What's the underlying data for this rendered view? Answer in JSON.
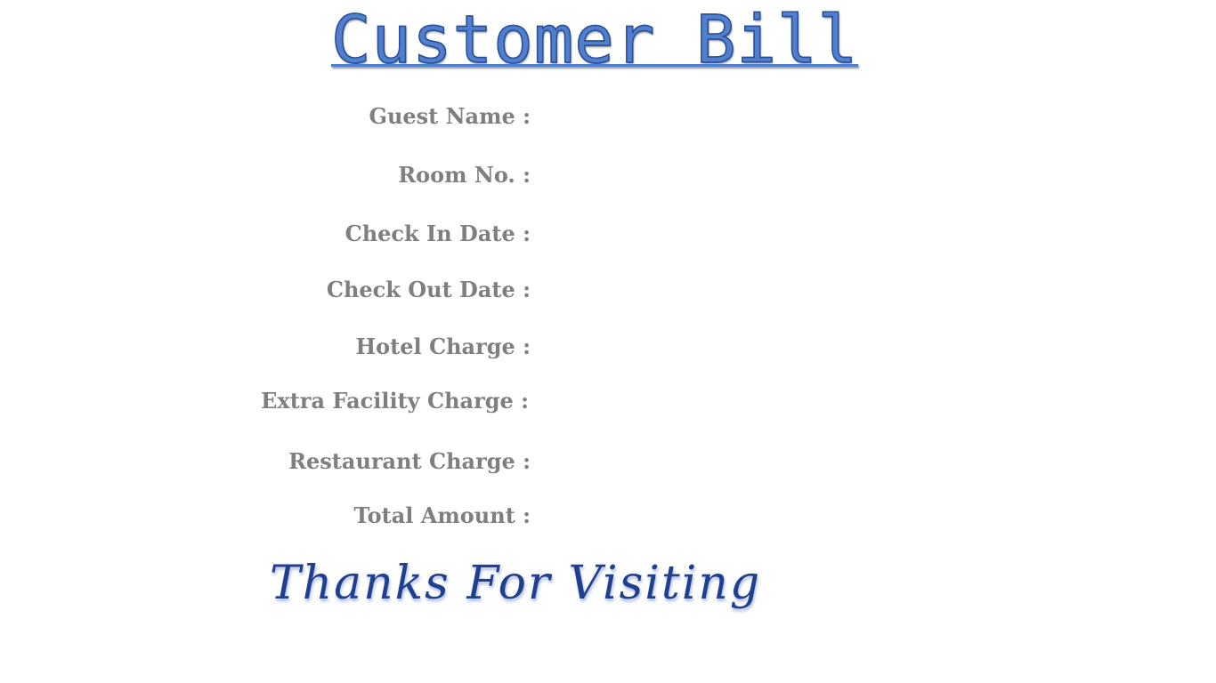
{
  "title": "Customer Bill",
  "fields": [
    {
      "label": "Guest Name :",
      "value": ""
    },
    {
      "label": "Room No. :",
      "value": ""
    },
    {
      "label": "Check In Date :",
      "value": ""
    },
    {
      "label": "Check Out Date :",
      "value": ""
    },
    {
      "label": "Hotel Charge :",
      "value": ""
    },
    {
      "label": "Extra Facility Charge :",
      "value": ""
    },
    {
      "label": "Restaurant Charge :",
      "value": ""
    },
    {
      "label": "Total Amount :",
      "value": ""
    }
  ],
  "footer": "Thanks For Visiting",
  "colors": {
    "title": "#4f7fce",
    "label": "#7f7f7f",
    "footer": "#1f3f8f",
    "background": "#ffffff"
  }
}
